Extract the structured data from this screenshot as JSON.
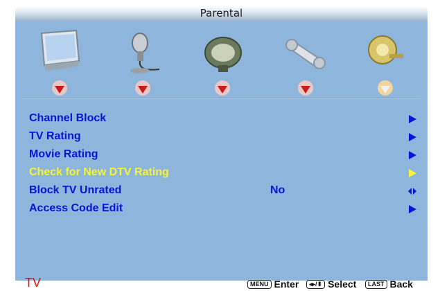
{
  "title": "Parental",
  "icons": [
    {
      "name": "picture-icon"
    },
    {
      "name": "audio-icon"
    },
    {
      "name": "tv-setup-icon"
    },
    {
      "name": "setup-tools-icon"
    },
    {
      "name": "parental-lock-icon"
    }
  ],
  "menu": {
    "items": [
      {
        "label": "Channel Block",
        "value": "",
        "marker": "right-arrow",
        "highlighted": false
      },
      {
        "label": "TV Rating",
        "value": "",
        "marker": "right-arrow",
        "highlighted": false
      },
      {
        "label": "Movie Rating",
        "value": "",
        "marker": "right-arrow",
        "highlighted": false
      },
      {
        "label": "Check for New DTV Rating",
        "value": "",
        "marker": "right-arrow",
        "highlighted": true
      },
      {
        "label": "Block TV Unrated",
        "value": "No",
        "marker": "left-right-arrow",
        "highlighted": false
      },
      {
        "label": "Access Code Edit",
        "value": "",
        "marker": "right-arrow",
        "highlighted": false
      }
    ]
  },
  "status": {
    "source": "TV",
    "enter_key": "MENU",
    "enter_label": "Enter",
    "select_key": "◂▸/⬍",
    "select_label": "Select",
    "back_key": "LAST",
    "back_label": "Back"
  },
  "colors": {
    "panel": "#8eb6dd",
    "item": "#0a12d8",
    "highlight": "#f4f43a",
    "source": "#e01010"
  }
}
